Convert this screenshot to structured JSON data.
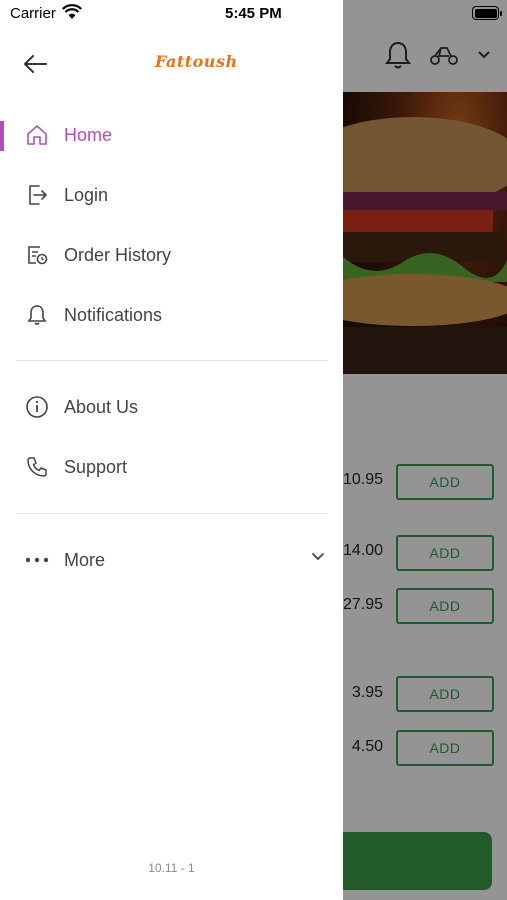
{
  "status_bar": {
    "carrier": "Carrier",
    "time": "5:45 PM"
  },
  "drawer": {
    "logo_text": "Fattoush",
    "menu_primary": [
      {
        "label": "Home",
        "icon": "home-icon",
        "active": true
      },
      {
        "label": "Login",
        "icon": "login-icon",
        "active": false
      },
      {
        "label": "Order History",
        "icon": "order-history-icon",
        "active": false
      },
      {
        "label": "Notifications",
        "icon": "bell-icon",
        "active": false
      }
    ],
    "menu_secondary": [
      {
        "label": "About Us",
        "icon": "info-icon"
      },
      {
        "label": "Support",
        "icon": "phone-icon"
      }
    ],
    "more_label": "More",
    "version": "10.11 - 1"
  },
  "background": {
    "prices": [
      "10.95",
      "14.00",
      "27.95",
      "3.95",
      "4.50"
    ],
    "add_label": "ADD"
  },
  "colors": {
    "accent": "#b04fb8",
    "logo": "#e5731b",
    "add_green": "#3a9a55"
  }
}
